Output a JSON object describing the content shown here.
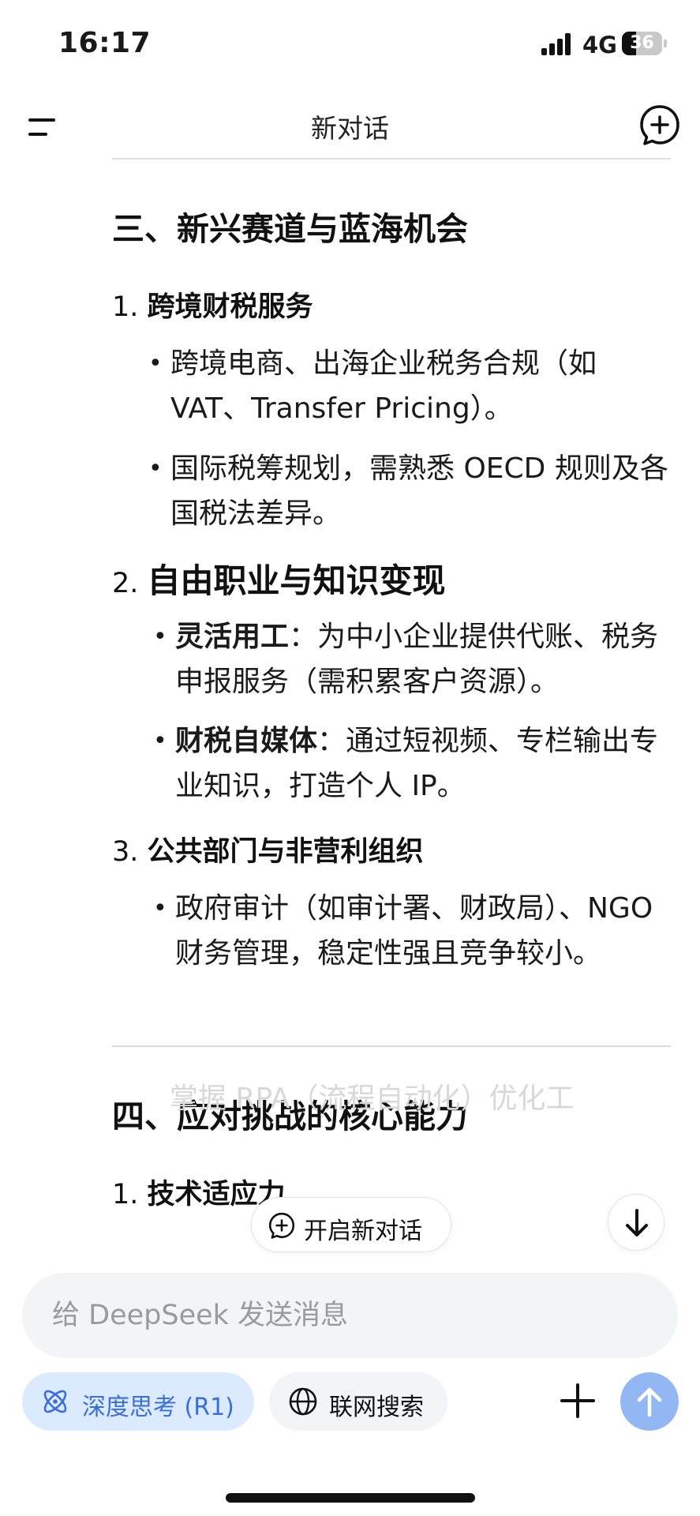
{
  "status_bar": {
    "time": "16:17",
    "network": "4G",
    "battery": "36",
    "battery_level": 0.36
  },
  "header": {
    "title": "新对话"
  },
  "content": {
    "section3": {
      "heading": "三、新兴赛道与蓝海机会",
      "item1": {
        "number": "1.",
        "title": "跨境财税服务",
        "bullets": [
          "跨境电商、出海企业税务合规（如VAT、Transfer Pricing）。",
          "国际税筹规划，需熟悉 OECD 规则及各国税法差异。"
        ]
      },
      "item2": {
        "number": "2.",
        "title": "自由职业与知识变现",
        "bullets": [
          {
            "bold": "灵活用工",
            "text": "：为中小企业提供代账、税务申报服务（需积累客户资源）。"
          },
          {
            "bold": "财税自媒体",
            "text": "：通过短视频、专栏输出专业知识，打造个人 IP。"
          }
        ]
      },
      "item3": {
        "number": "3.",
        "title": "公共部门与非营利组织",
        "bullets": [
          "政府审计（如审计署、财政局）、NGO 财务管理，稳定性强且竞争较小。"
        ]
      }
    },
    "section4": {
      "heading": "四、应对挑战的核心能力",
      "item1": {
        "number": "1.",
        "title": "技术适应力"
      },
      "faded_text": "掌握 RPA（流程自动化）优化工"
    }
  },
  "floating": {
    "new_chat_label": "开启新对话"
  },
  "composer": {
    "placeholder": "给 DeepSeek 发送消息",
    "deep_think_label": "深度思考 (R1)",
    "web_search_label": "联网搜索"
  },
  "colors": {
    "accent": "#3b6fd8",
    "deep_think_bg": "#dbeafe",
    "send_button": "#93b7f3",
    "input_bg": "#f3f4f6"
  }
}
